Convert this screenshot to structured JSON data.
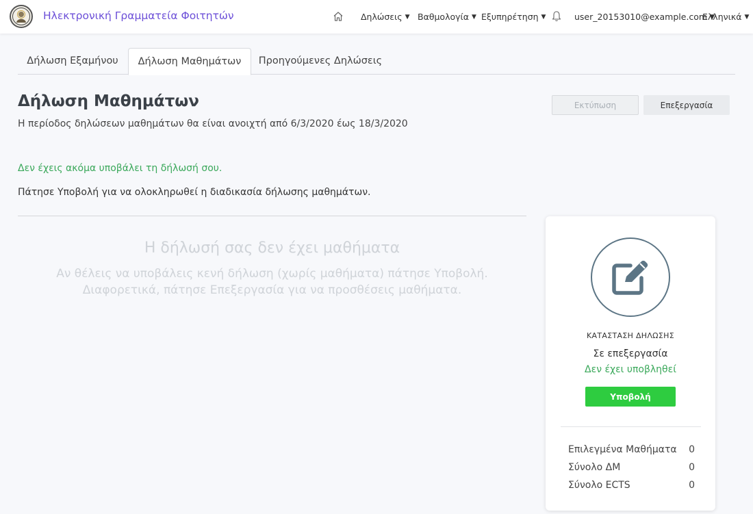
{
  "header": {
    "app_title": "Ηλεκτρονική Γραμματεία Φοιτητών",
    "nav": [
      {
        "label": "Δηλώσεις"
      },
      {
        "label": "Βαθμολογία"
      },
      {
        "label": "Εξυπηρέτηση"
      }
    ],
    "user_email": "user_20153010@example.com",
    "language": "Ελληνικά"
  },
  "tabs": [
    {
      "label": "Δήλωση Εξαμήνου",
      "active": false
    },
    {
      "label": "Δήλωση Μαθημάτων",
      "active": true
    },
    {
      "label": "Προηγούμενες Δηλώσεις",
      "active": false
    }
  ],
  "main": {
    "title": "Δήλωση Μαθημάτων",
    "subtitle": "Η περίοδος δηλώσεων μαθημάτων θα είναι ανοιχτή από 6/3/2020 έως 18/3/2020",
    "print_label": "Εκτύπωση",
    "edit_label": "Επεξεργασία",
    "warning": "Δεν έχεις ακόμα υποβάλει τη δήλωσή σου.",
    "info": "Πάτησε Υποβολή για να ολοκληρωθεί η διαδικασία δήλωσης μαθημάτων.",
    "empty_title": "Η δήλωσή σας δεν έχει μαθήματα",
    "empty_line1": "Αν θέλεις να υποβάλεις κενή δήλωση (χωρίς μαθήματα) πάτησε Υποβολή.",
    "empty_line2": "Διαφορετικά, πάτησε Επεξεργασία για να προσθέσεις μαθήματα."
  },
  "status_card": {
    "label": "ΚΑΤΑΣΤΑΣΗ ΔΗΛΩΣΗΣ",
    "value": "Σε επεξεργασία",
    "sub_status": "Δεν έχει υποβληθεί",
    "submit_label": "Υποβολή",
    "stats": [
      {
        "label": "Επιλεγμένα Μαθήματα",
        "value": "0"
      },
      {
        "label": "Σύνολο ΔΜ",
        "value": "0"
      },
      {
        "label": "Σύνολο ECTS",
        "value": "0"
      }
    ]
  },
  "colors": {
    "brand": "#6c4fd8",
    "success": "#3aa85a",
    "submit": "#2ecc40",
    "status_icon": "#5c7585"
  },
  "icons": [
    "university-seal-icon",
    "home-icon",
    "bell-icon",
    "edit-icon",
    "chevron-down-icon"
  ]
}
